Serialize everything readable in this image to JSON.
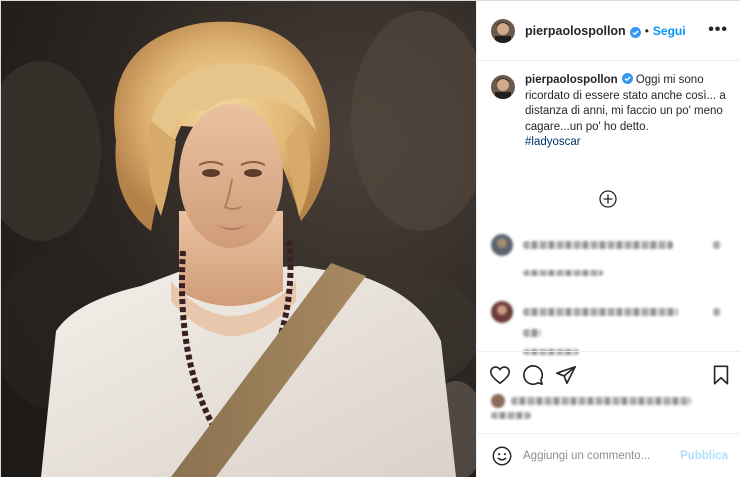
{
  "post": {
    "username": "pierpaolospollon",
    "follow_label": "Segui",
    "separator": "•",
    "more_label": "•••",
    "caption": "Oggi mi sono ricordato di essere stato anche così... a distanza di anni, mi faccio un po' meno cagare...un po' ho detto.",
    "hashtag": "#ladyoscar"
  },
  "comment_box": {
    "placeholder": "Aggiungi un commento...",
    "publish_label": "Pubblica"
  },
  "icons": {
    "more": "more-options-icon",
    "load_more": "plus-circle-icon",
    "like": "heart-icon",
    "comment": "comment-bubble-icon",
    "share": "paper-plane-icon",
    "save": "bookmark-icon",
    "emoji": "smiley-icon",
    "verified": "verified-badge-icon"
  },
  "colors": {
    "accent": "#0095f6",
    "publish_disabled": "#b2dffc",
    "hashtag": "#00376b",
    "text": "#262626",
    "muted": "#8e8e8e",
    "border": "#efefef"
  }
}
